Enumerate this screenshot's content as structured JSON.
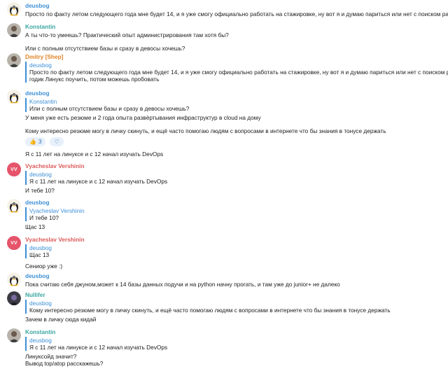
{
  "messages": [
    {
      "author": "deusbog",
      "lines": [
        "Просто по факту летом следующего года мне будет 14, и я уже смогу официально работать на стажировке, ну вот я и думаю париться или нет с поиском работы"
      ]
    },
    {
      "author": "Konstantin",
      "lines": [
        "А ты что-то умеешь? Практический опыт администрирования там хотя бы?",
        "Или с полным отсутствием базы и сразу в девосы хочешь?"
      ]
    },
    {
      "author": "Dmitry [Shep]",
      "quote_author": "deusbog",
      "quote_lines": [
        "Просто по факту летом следующего года мне будет 14, и я уже смогу официально работать на стажировке, ну вот я и думаю париться или нет с поиском работы"
      ],
      "lines": [
        "годик Линукс поучить, потом можешь пробовать"
      ]
    },
    {
      "author": "deusbog",
      "quote_author": "Konstantin",
      "quote_lines": [
        "Или с полным отсутствием базы и сразу в девосы хочешь?"
      ],
      "lines": [
        "У меня уже есть резюме и 2 года опыта развёртывания инфраструктур в cloud на дому",
        "Кому интересно резюме могу в личку скинуть, и ещё часто помогаю людям с вопросами в интернете что бы знания в тонусе держать"
      ],
      "reactions": [
        {
          "emoji": "👍",
          "count": "3"
        },
        {
          "emoji": "♡",
          "count": ""
        }
      ],
      "after": "Я с 11 лет на линуксе и с 12 начал изучать DevOps"
    },
    {
      "author": "Vyacheslav Vershinin",
      "initials": "VV",
      "quote_author": "deusbog",
      "quote_lines": [
        "Я с 11 лет на линуксе и с 12 начал изучать DevOps"
      ],
      "lines": [
        "И тебе 10?"
      ]
    },
    {
      "author": "deusbog",
      "quote_author": "Vyacheslav Vershinin",
      "quote_lines": [
        "И тебе 10?"
      ],
      "lines": [
        "Щас 13"
      ]
    },
    {
      "author": "Vyacheslav Vershinin",
      "initials": "VV",
      "quote_author": "deusbog",
      "quote_lines": [
        "Щас 13"
      ],
      "lines": [
        "Сениор уже :)"
      ]
    },
    {
      "author": "deusbog",
      "lines": [
        "Пока считаю себя джуном,может к 14 базы данных подучи и на python начну прогать, и там уже до junior+ не далеко"
      ]
    },
    {
      "author": "Nullifer",
      "quote_author": "deusbog",
      "quote_lines": [
        "Кому интересно резюме могу в личку скинуть, и ещё часто помогаю людям с вопросами в интернете что бы знания в тонусе держать"
      ],
      "lines": [
        "Зачем в личку сюда кидай"
      ]
    },
    {
      "author": "Konstantin",
      "quote_author": "deusbog",
      "quote_lines": [
        "Я с 11 лет на линуксе и с 12 начал изучать DevOps"
      ],
      "lines": [
        "Линуксойд значит?",
        "Вывод top/atop расскажешь?"
      ]
    }
  ],
  "colors": {
    "quote_accent": "#3d8fd6",
    "deusbog": "#3d8fd6",
    "konstantin": "#3aa6a0",
    "dmitry": "#e0852a",
    "vyacheslav": "#dc5a5a",
    "nullifer": "#3aa6a0"
  }
}
